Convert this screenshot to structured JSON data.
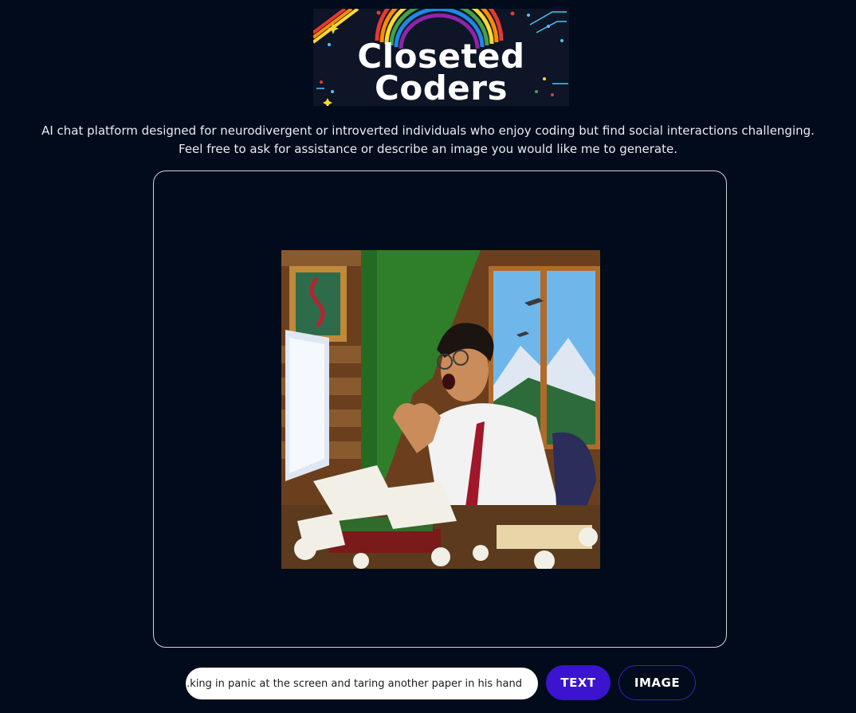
{
  "logo": {
    "line1": "Closeted",
    "line2": "Coders"
  },
  "description": {
    "line1": "AI chat platform designed for neurodivergent or introverted individuals who enjoy coding but find social interactions challenging.",
    "line2": "Feel free to ask for assistance or describe an image you would like me to generate."
  },
  "prompt": {
    "value": "…king in panic at the screen and taring another paper in his hand"
  },
  "buttons": {
    "text_label": "TEXT",
    "image_label": "IMAGE"
  },
  "colors": {
    "background": "#010b1b",
    "accent": "#3a14cf"
  }
}
